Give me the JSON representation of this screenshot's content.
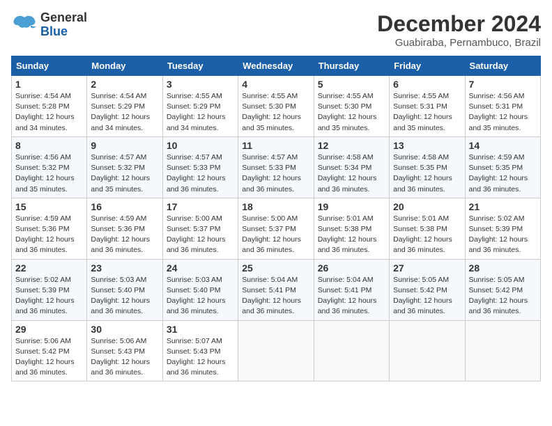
{
  "header": {
    "logo_general": "General",
    "logo_blue": "Blue",
    "month": "December 2024",
    "location": "Guabiraba, Pernambuco, Brazil"
  },
  "weekdays": [
    "Sunday",
    "Monday",
    "Tuesday",
    "Wednesday",
    "Thursday",
    "Friday",
    "Saturday"
  ],
  "weeks": [
    [
      {
        "day": "1",
        "sunrise": "4:54 AM",
        "sunset": "5:28 PM",
        "daylight": "12 hours and 34 minutes."
      },
      {
        "day": "2",
        "sunrise": "4:54 AM",
        "sunset": "5:29 PM",
        "daylight": "12 hours and 34 minutes."
      },
      {
        "day": "3",
        "sunrise": "4:55 AM",
        "sunset": "5:29 PM",
        "daylight": "12 hours and 34 minutes."
      },
      {
        "day": "4",
        "sunrise": "4:55 AM",
        "sunset": "5:30 PM",
        "daylight": "12 hours and 35 minutes."
      },
      {
        "day": "5",
        "sunrise": "4:55 AM",
        "sunset": "5:30 PM",
        "daylight": "12 hours and 35 minutes."
      },
      {
        "day": "6",
        "sunrise": "4:55 AM",
        "sunset": "5:31 PM",
        "daylight": "12 hours and 35 minutes."
      },
      {
        "day": "7",
        "sunrise": "4:56 AM",
        "sunset": "5:31 PM",
        "daylight": "12 hours and 35 minutes."
      }
    ],
    [
      {
        "day": "8",
        "sunrise": "4:56 AM",
        "sunset": "5:32 PM",
        "daylight": "12 hours and 35 minutes."
      },
      {
        "day": "9",
        "sunrise": "4:57 AM",
        "sunset": "5:32 PM",
        "daylight": "12 hours and 35 minutes."
      },
      {
        "day": "10",
        "sunrise": "4:57 AM",
        "sunset": "5:33 PM",
        "daylight": "12 hours and 36 minutes."
      },
      {
        "day": "11",
        "sunrise": "4:57 AM",
        "sunset": "5:33 PM",
        "daylight": "12 hours and 36 minutes."
      },
      {
        "day": "12",
        "sunrise": "4:58 AM",
        "sunset": "5:34 PM",
        "daylight": "12 hours and 36 minutes."
      },
      {
        "day": "13",
        "sunrise": "4:58 AM",
        "sunset": "5:35 PM",
        "daylight": "12 hours and 36 minutes."
      },
      {
        "day": "14",
        "sunrise": "4:59 AM",
        "sunset": "5:35 PM",
        "daylight": "12 hours and 36 minutes."
      }
    ],
    [
      {
        "day": "15",
        "sunrise": "4:59 AM",
        "sunset": "5:36 PM",
        "daylight": "12 hours and 36 minutes."
      },
      {
        "day": "16",
        "sunrise": "4:59 AM",
        "sunset": "5:36 PM",
        "daylight": "12 hours and 36 minutes."
      },
      {
        "day": "17",
        "sunrise": "5:00 AM",
        "sunset": "5:37 PM",
        "daylight": "12 hours and 36 minutes."
      },
      {
        "day": "18",
        "sunrise": "5:00 AM",
        "sunset": "5:37 PM",
        "daylight": "12 hours and 36 minutes."
      },
      {
        "day": "19",
        "sunrise": "5:01 AM",
        "sunset": "5:38 PM",
        "daylight": "12 hours and 36 minutes."
      },
      {
        "day": "20",
        "sunrise": "5:01 AM",
        "sunset": "5:38 PM",
        "daylight": "12 hours and 36 minutes."
      },
      {
        "day": "21",
        "sunrise": "5:02 AM",
        "sunset": "5:39 PM",
        "daylight": "12 hours and 36 minutes."
      }
    ],
    [
      {
        "day": "22",
        "sunrise": "5:02 AM",
        "sunset": "5:39 PM",
        "daylight": "12 hours and 36 minutes."
      },
      {
        "day": "23",
        "sunrise": "5:03 AM",
        "sunset": "5:40 PM",
        "daylight": "12 hours and 36 minutes."
      },
      {
        "day": "24",
        "sunrise": "5:03 AM",
        "sunset": "5:40 PM",
        "daylight": "12 hours and 36 minutes."
      },
      {
        "day": "25",
        "sunrise": "5:04 AM",
        "sunset": "5:41 PM",
        "daylight": "12 hours and 36 minutes."
      },
      {
        "day": "26",
        "sunrise": "5:04 AM",
        "sunset": "5:41 PM",
        "daylight": "12 hours and 36 minutes."
      },
      {
        "day": "27",
        "sunrise": "5:05 AM",
        "sunset": "5:42 PM",
        "daylight": "12 hours and 36 minutes."
      },
      {
        "day": "28",
        "sunrise": "5:05 AM",
        "sunset": "5:42 PM",
        "daylight": "12 hours and 36 minutes."
      }
    ],
    [
      {
        "day": "29",
        "sunrise": "5:06 AM",
        "sunset": "5:42 PM",
        "daylight": "12 hours and 36 minutes."
      },
      {
        "day": "30",
        "sunrise": "5:06 AM",
        "sunset": "5:43 PM",
        "daylight": "12 hours and 36 minutes."
      },
      {
        "day": "31",
        "sunrise": "5:07 AM",
        "sunset": "5:43 PM",
        "daylight": "12 hours and 36 minutes."
      },
      null,
      null,
      null,
      null
    ]
  ],
  "labels": {
    "sunrise_prefix": "Sunrise: ",
    "sunset_prefix": "Sunset: ",
    "daylight_prefix": "Daylight: "
  }
}
